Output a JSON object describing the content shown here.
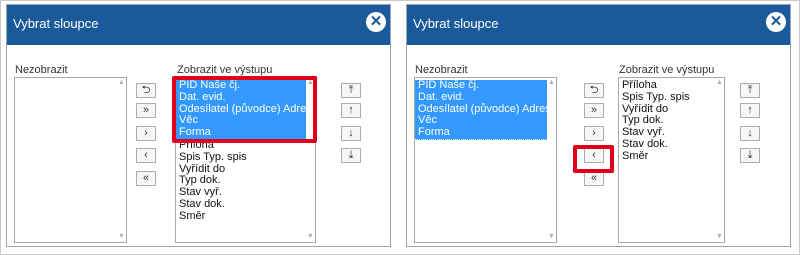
{
  "panels": [
    {
      "title": "Vybrat sloupce",
      "close_icon": "✕",
      "left_label": "Nezobrazit",
      "right_label": "Zobrazit ve výstupu",
      "left_items": [],
      "right_items": [
        {
          "label": "PID Naše čj.",
          "selected": true
        },
        {
          "label": "Dat. evid.",
          "selected": true
        },
        {
          "label": "Odesílatel (původce) Adresát",
          "selected": true
        },
        {
          "label": "Věc",
          "selected": true
        },
        {
          "label": "Forma",
          "selected": true
        },
        {
          "label": "Příloha",
          "selected": false
        },
        {
          "label": "Spis Typ. spis",
          "selected": false
        },
        {
          "label": "Vyřídit do",
          "selected": false
        },
        {
          "label": "Typ dok.",
          "selected": false
        },
        {
          "label": "Stav vyř.",
          "selected": false
        },
        {
          "label": "Stav dok.",
          "selected": false
        },
        {
          "label": "Směr",
          "selected": false
        }
      ]
    },
    {
      "title": "Vybrat sloupce",
      "close_icon": "✕",
      "left_label": "Nezobrazit",
      "right_label": "Zobrazit ve výstupu",
      "left_items": [
        {
          "label": "PID Naše čj.",
          "selected": true
        },
        {
          "label": "Dat. evid.",
          "selected": true
        },
        {
          "label": "Odesílatel (původce) Adresát",
          "selected": true
        },
        {
          "label": "Věc",
          "selected": true
        },
        {
          "label": "Forma",
          "selected": true
        }
      ],
      "right_items": [
        {
          "label": "Příloha",
          "selected": false
        },
        {
          "label": "Spis Typ. spis",
          "selected": false
        },
        {
          "label": "Vyřídit do",
          "selected": false
        },
        {
          "label": "Typ dok.",
          "selected": false
        },
        {
          "label": "Stav vyř.",
          "selected": false
        },
        {
          "label": "Stav dok.",
          "selected": false
        },
        {
          "label": "Směr",
          "selected": false
        }
      ]
    }
  ],
  "transfer_buttons": [
    {
      "name": "reset-button",
      "icon": "undo-icon",
      "glyph": "⮌"
    },
    {
      "name": "move-all-right-button",
      "icon": "double-chevron-right-icon",
      "glyph": "»"
    },
    {
      "name": "move-right-button",
      "icon": "chevron-right-icon",
      "glyph": "›"
    },
    {
      "name": "move-left-button",
      "icon": "chevron-left-icon",
      "glyph": "‹"
    },
    {
      "name": "move-all-left-button",
      "icon": "double-chevron-left-icon",
      "glyph": "«"
    }
  ],
  "order_buttons": [
    {
      "name": "move-to-top-button",
      "icon": "arrow-to-top-icon",
      "glyph": "⤒"
    },
    {
      "name": "move-up-button",
      "icon": "arrow-up-icon",
      "glyph": "↑"
    },
    {
      "name": "move-down-button",
      "icon": "arrow-down-icon",
      "glyph": "↓"
    },
    {
      "name": "move-to-bottom-button",
      "icon": "arrow-to-bottom-icon",
      "glyph": "⤓"
    }
  ],
  "colors": {
    "titlebar": "#1b5a9a",
    "selection": "#3399ff",
    "highlight_frame": "#e0001b"
  }
}
